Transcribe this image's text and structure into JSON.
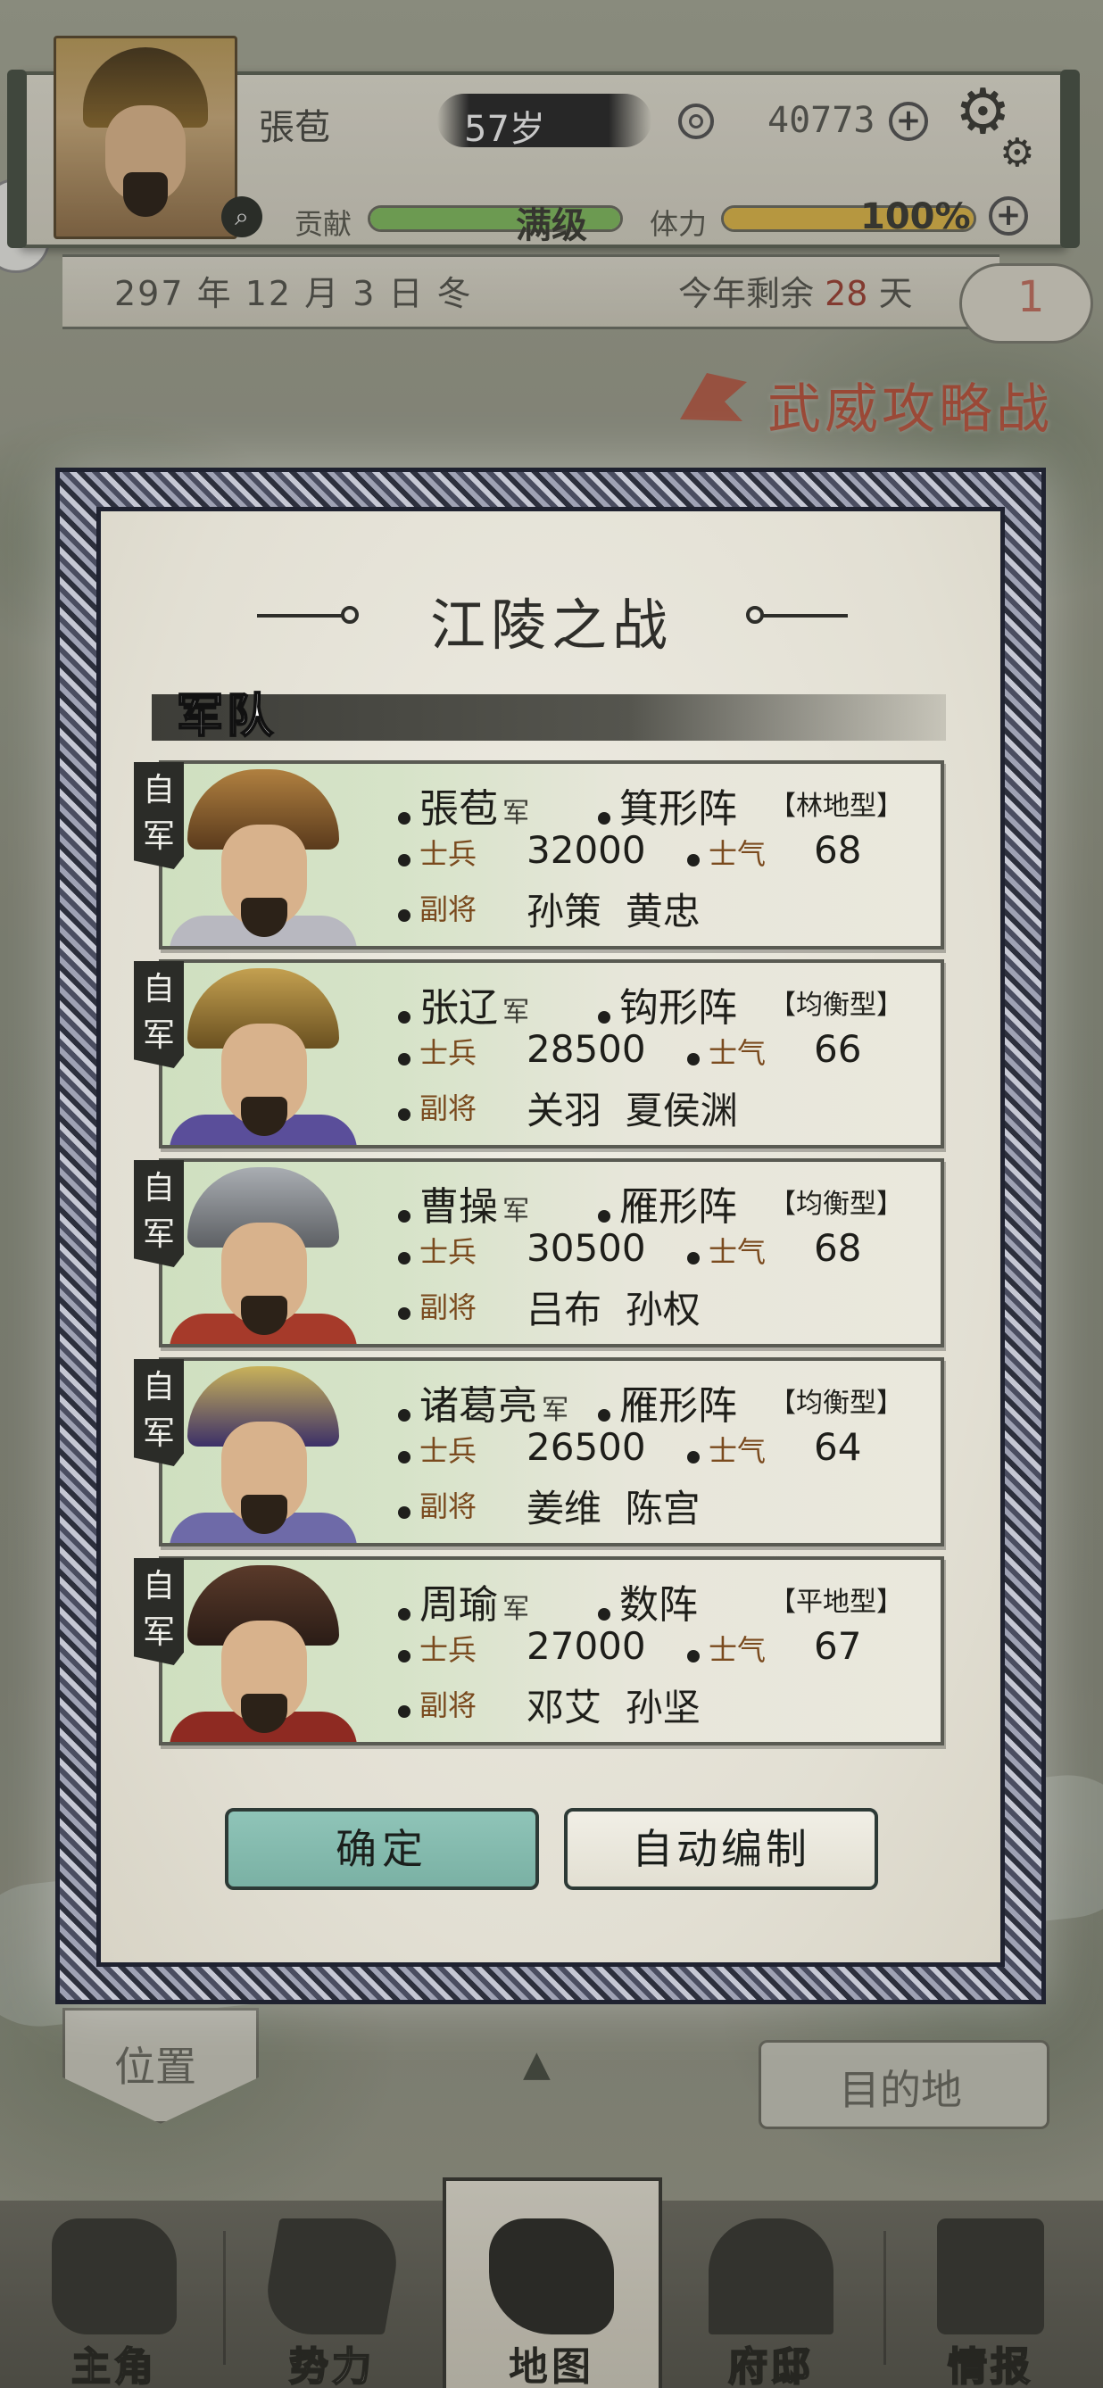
{
  "header": {
    "player_name": "張苞",
    "age": "57岁",
    "coins": "40773",
    "contribution_label": "贡献",
    "contribution_value": "满级",
    "contribution_fill": 1.0,
    "stamina_label": "体力",
    "stamina_value": "100%",
    "stamina_fill": 1.0,
    "date": "297 年 12 月 3 日 冬",
    "remain_prefix": "今年剩余",
    "remain_days": "28",
    "remain_suffix": "天",
    "notification_count": "1"
  },
  "event": {
    "title": "武威攻略战"
  },
  "modal": {
    "title": "江陵之战",
    "section": "军队",
    "own_tag": "自军",
    "soldier_label": "士兵",
    "morale_label": "士气",
    "deputy_label": "副将",
    "jun_label": "军",
    "armies": [
      {
        "name": "張苞",
        "formation": "箕形阵",
        "terrain": "【林地型】",
        "soldiers": "32000",
        "morale": "68",
        "deputies": "孙策  黄忠"
      },
      {
        "name": "张辽",
        "formation": "钩形阵",
        "terrain": "【均衡型】",
        "soldiers": "28500",
        "morale": "66",
        "deputies": "关羽  夏侯渊"
      },
      {
        "name": "曹操",
        "formation": "雁形阵",
        "terrain": "【均衡型】",
        "soldiers": "30500",
        "morale": "68",
        "deputies": "吕布  孙权"
      },
      {
        "name": "诸葛亮",
        "formation": "雁形阵",
        "terrain": "【均衡型】",
        "soldiers": "26500",
        "morale": "64",
        "deputies": "姜维  陈宫"
      },
      {
        "name": "周瑜",
        "formation": "数阵",
        "terrain": "【平地型】",
        "soldiers": "27000",
        "morale": "67",
        "deputies": "邓艾  孙坚"
      }
    ],
    "confirm_label": "确定",
    "auto_label": "自动编制"
  },
  "map_controls": {
    "locate_label": "位置",
    "destination_label": "目的地"
  },
  "nav": {
    "items": [
      {
        "label": "主角",
        "icon": "hero-icon"
      },
      {
        "label": "势力",
        "icon": "flag-icon"
      },
      {
        "label": "地图",
        "icon": "map-icon"
      },
      {
        "label": "府邸",
        "icon": "mansion-icon"
      },
      {
        "label": "情报",
        "icon": "scroll-icon"
      }
    ],
    "active": "地图"
  },
  "colors": {
    "contribution_bar": "#7fb85e",
    "stamina_bar": "#d9b44a",
    "event_red": "#b8543e",
    "confirm_button": "#8fc4b8"
  }
}
